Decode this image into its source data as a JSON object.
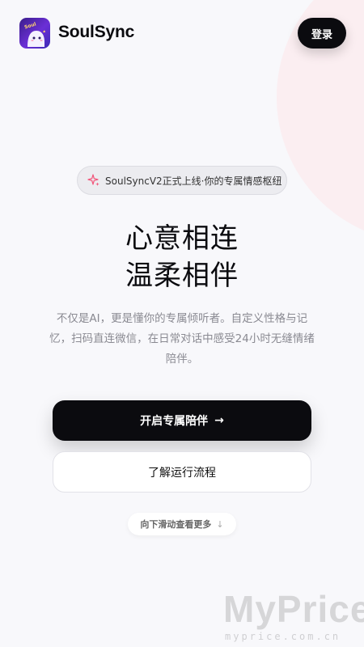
{
  "header": {
    "brand": "SoulSync",
    "login_label": "登录",
    "logo_icon": "ghost-mascot-icon"
  },
  "hero": {
    "badge_text": "SoulSyncV2正式上线·你的专属情感枢纽",
    "badge_icon": "sparkle-icon",
    "headline_line1": "心意相连",
    "headline_line2": "温柔相伴",
    "subtitle": "不仅是AI，更是懂你的专属倾听者。自定义性格与记忆，扫码直连微信，在日常对话中感受24小时无缝情绪陪伴。"
  },
  "actions": {
    "primary_label": "开启专属陪伴",
    "primary_arrow": "→",
    "secondary_label": "了解运行流程"
  },
  "scroll_hint": {
    "label": "向下滑动查看更多",
    "arrow": "↓"
  },
  "watermark": {
    "main": "MyPrice",
    "sub": "myprice.com.cn"
  },
  "colors": {
    "primary": "#0b0b0f",
    "background": "#f8f8fb",
    "accent_pink": "#fbecef",
    "logo_purple": "#6b2fd6"
  }
}
